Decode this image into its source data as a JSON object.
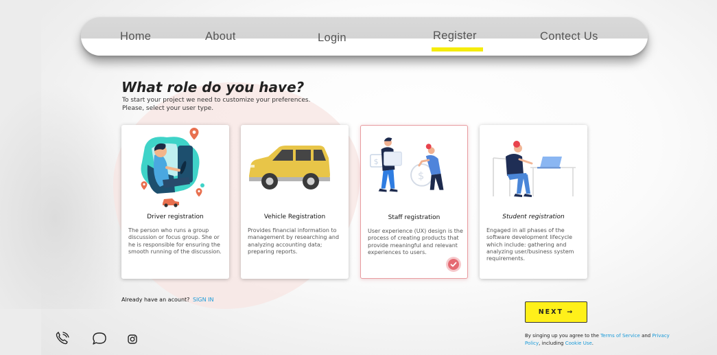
{
  "nav": {
    "items": [
      {
        "label": "Home"
      },
      {
        "label": "About"
      },
      {
        "label": "Login"
      },
      {
        "label": "Register"
      },
      {
        "label": "Contect Us"
      }
    ],
    "active_index": 3,
    "active_color": "#f5ec0c"
  },
  "heading": {
    "title": "What role do you have?",
    "subtitle_line1": "To start your project we need to customize your preferences.",
    "subtitle_line2": "Please, select your user type."
  },
  "cards": [
    {
      "title": "Driver registration",
      "description": "The person who runs a group discussion or focus group. She or he is responsible for ensuring the smooth running of the discussion.",
      "icon": "driver-illustration",
      "selected": false
    },
    {
      "title": "Vehicle Registration",
      "description": "Provides financial information to management by researching and analyzing accounting data; preparing reports.",
      "icon": "car-illustration",
      "selected": false
    },
    {
      "title": "Staff registration",
      "description": "User experience (UX) design is the process of creating products that provide meaningful and relevant experiences to users.",
      "icon": "staff-illustration",
      "selected": true
    },
    {
      "title": "Student registration",
      "description": "Engaged in all phases of the software development lifecycle which include: gathering and analyzing user/business system requirements.",
      "icon": "student-illustration",
      "selected": false
    }
  ],
  "account": {
    "prompt": "Already have an acount?",
    "signin_label": "SIGN IN"
  },
  "next_button": {
    "label": "NEXT →"
  },
  "legal": {
    "prefix": "By singing up you agree to the",
    "terms_link": "Terms of Service",
    "and": "and",
    "privacy_link": "Privacy Policy",
    "including": ", including",
    "cookie_link": "Cookie Use",
    "suffix": "."
  },
  "social": [
    "phone-icon",
    "chat-icon",
    "instagram-icon"
  ],
  "colors": {
    "accent_yellow": "#fff01a",
    "link_blue": "#1a9ad8",
    "selected_border": "#e89b9f",
    "check_red": "#e56a72"
  }
}
